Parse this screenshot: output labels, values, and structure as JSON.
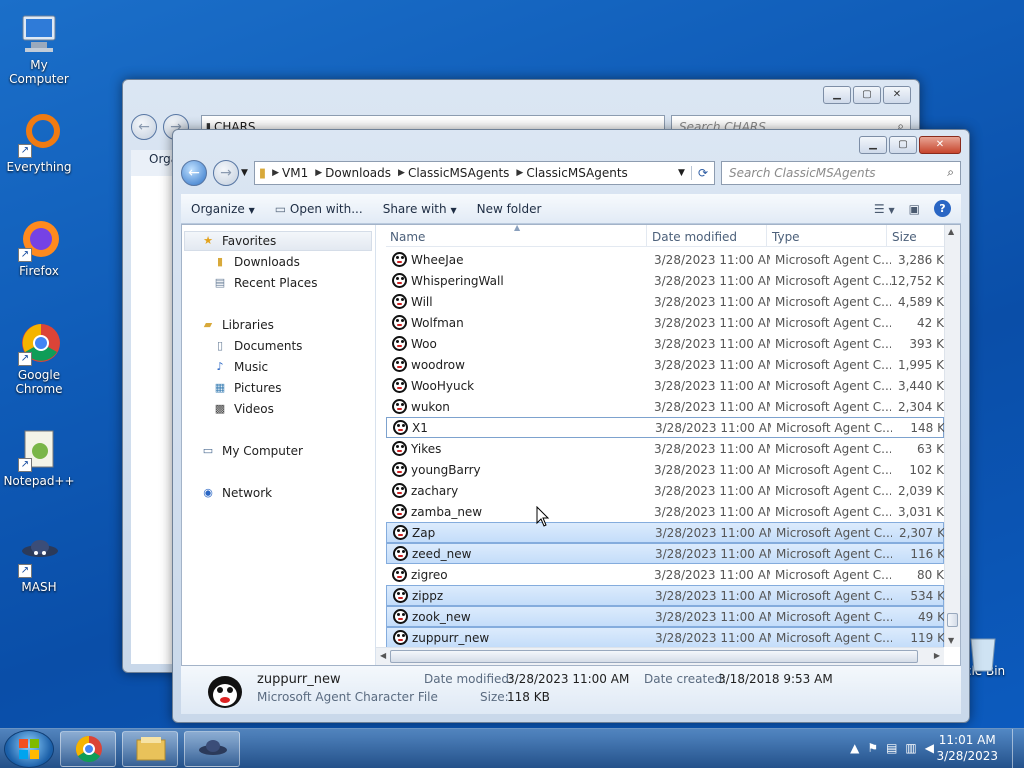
{
  "desktop": {
    "icons": [
      {
        "label": "My Computer"
      },
      {
        "label": "Everything"
      },
      {
        "label": "Firefox"
      },
      {
        "label": "Google Chrome"
      },
      {
        "label": "Notepad++"
      },
      {
        "label": "MASH"
      },
      {
        "label": "cle Bin"
      }
    ]
  },
  "back_window": {
    "address": "CHARS",
    "search_placeholder": "Search CHARS",
    "toolbar_partial": "Orga"
  },
  "window": {
    "breadcrumb": [
      "VM1",
      "Downloads",
      "ClassicMSAgents",
      "ClassicMSAgents"
    ],
    "search_placeholder": "Search ClassicMSAgents",
    "toolbar": {
      "organize": "Organize",
      "open_with": "Open with...",
      "share_with": "Share with",
      "new_folder": "New folder"
    },
    "nav": {
      "favorites": "Favorites",
      "downloads": "Downloads",
      "recent_places": "Recent Places",
      "libraries": "Libraries",
      "documents": "Documents",
      "music": "Music",
      "pictures": "Pictures",
      "videos": "Videos",
      "my_computer": "My Computer",
      "network": "Network"
    },
    "columns": {
      "name": "Name",
      "date": "Date modified",
      "type": "Type",
      "size": "Size"
    },
    "files": [
      {
        "name": "WheeJae",
        "date": "3/28/2023 11:00 AM",
        "type": "Microsoft Agent C...",
        "size": "3,286 K"
      },
      {
        "name": "WhisperingWall",
        "date": "3/28/2023 11:00 AM",
        "type": "Microsoft Agent C...",
        "size": "12,752 K"
      },
      {
        "name": "Will",
        "date": "3/28/2023 11:00 AM",
        "type": "Microsoft Agent C...",
        "size": "4,589 K"
      },
      {
        "name": "Wolfman",
        "date": "3/28/2023 11:00 AM",
        "type": "Microsoft Agent C...",
        "size": "42 K"
      },
      {
        "name": "Woo",
        "date": "3/28/2023 11:00 AM",
        "type": "Microsoft Agent C...",
        "size": "393 K"
      },
      {
        "name": "woodrow",
        "date": "3/28/2023 11:00 AM",
        "type": "Microsoft Agent C...",
        "size": "1,995 K"
      },
      {
        "name": "WooHyuck",
        "date": "3/28/2023 11:00 AM",
        "type": "Microsoft Agent C...",
        "size": "3,440 K"
      },
      {
        "name": "wukon",
        "date": "3/28/2023 11:00 AM",
        "type": "Microsoft Agent C...",
        "size": "2,304 K"
      },
      {
        "name": "X1",
        "date": "3/28/2023 11:00 AM",
        "type": "Microsoft Agent C...",
        "size": "148 K"
      },
      {
        "name": "Yikes",
        "date": "3/28/2023 11:00 AM",
        "type": "Microsoft Agent C...",
        "size": "63 K"
      },
      {
        "name": "youngBarry",
        "date": "3/28/2023 11:00 AM",
        "type": "Microsoft Agent C...",
        "size": "102 K"
      },
      {
        "name": "zachary",
        "date": "3/28/2023 11:00 AM",
        "type": "Microsoft Agent C...",
        "size": "2,039 K"
      },
      {
        "name": "zamba_new",
        "date": "3/28/2023 11:00 AM",
        "type": "Microsoft Agent C...",
        "size": "3,031 K"
      },
      {
        "name": "Zap",
        "date": "3/28/2023 11:00 AM",
        "type": "Microsoft Agent C...",
        "size": "2,307 K"
      },
      {
        "name": "zeed_new",
        "date": "3/28/2023 11:00 AM",
        "type": "Microsoft Agent C...",
        "size": "116 K"
      },
      {
        "name": "zigreo",
        "date": "3/28/2023 11:00 AM",
        "type": "Microsoft Agent C...",
        "size": "80 K"
      },
      {
        "name": "zippz",
        "date": "3/28/2023 11:00 AM",
        "type": "Microsoft Agent C...",
        "size": "534 K"
      },
      {
        "name": "zook_new",
        "date": "3/28/2023 11:00 AM",
        "type": "Microsoft Agent C...",
        "size": "49 K"
      },
      {
        "name": "zuppurr_new",
        "date": "3/28/2023 11:00 AM",
        "type": "Microsoft Agent C...",
        "size": "119 K"
      }
    ],
    "details": {
      "name": "zuppurr_new",
      "type": "Microsoft Agent Character File",
      "modified_label": "Date modified:",
      "modified": "3/28/2023 11:00 AM",
      "created_label": "Date created:",
      "created": "3/18/2018 9:53 AM",
      "size_label": "Size:",
      "size": "118 KB"
    }
  },
  "taskbar": {
    "time": "11:01 AM",
    "date": "3/28/2023"
  }
}
